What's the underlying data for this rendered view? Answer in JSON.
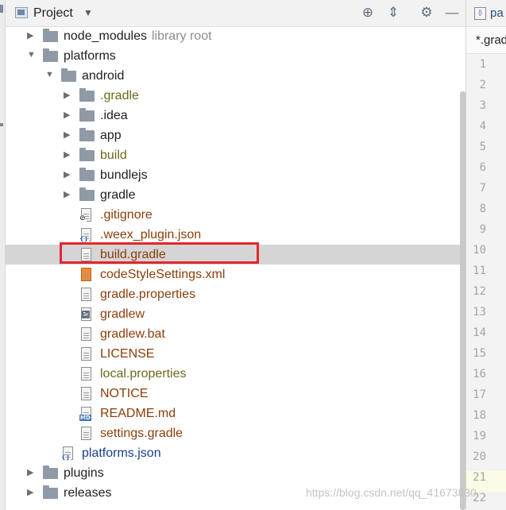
{
  "header": {
    "title": "Project",
    "dropdown_icon": "caret-down-icon",
    "toolbar_icons": [
      "locate-icon",
      "collapse-all-icon",
      "gear-icon",
      "minimize-icon"
    ]
  },
  "tree": [
    {
      "label": "node_modules",
      "hint": "library root",
      "kind": "folder",
      "depth": 0,
      "arrow": "right",
      "color": "black"
    },
    {
      "label": "platforms",
      "kind": "folder",
      "depth": 0,
      "arrow": "down",
      "color": "black"
    },
    {
      "label": "android",
      "kind": "folder",
      "depth": 1,
      "arrow": "down",
      "color": "black"
    },
    {
      "label": ".gradle",
      "kind": "folder",
      "depth": 2,
      "arrow": "right",
      "color": "olive"
    },
    {
      "label": ".idea",
      "kind": "folder",
      "depth": 2,
      "arrow": "right",
      "color": "black"
    },
    {
      "label": "app",
      "kind": "folder",
      "depth": 2,
      "arrow": "right",
      "color": "black"
    },
    {
      "label": "build",
      "kind": "folder",
      "depth": 2,
      "arrow": "right",
      "color": "olive"
    },
    {
      "label": "bundlejs",
      "kind": "folder",
      "depth": 2,
      "arrow": "right",
      "color": "black"
    },
    {
      "label": "gradle",
      "kind": "folder",
      "depth": 2,
      "arrow": "right",
      "color": "black"
    },
    {
      "label": ".gitignore",
      "kind": "file",
      "depth": 2,
      "file_icon": "gitignore-file-icon",
      "color": "brown"
    },
    {
      "label": ".weex_plugin.json",
      "kind": "file",
      "depth": 2,
      "file_icon": "json-file-icon",
      "color": "brown"
    },
    {
      "label": "build.gradle",
      "kind": "file",
      "depth": 2,
      "file_icon": "text-file-icon",
      "color": "brown",
      "selected": true
    },
    {
      "label": "codeStyleSettings.xml",
      "kind": "file",
      "depth": 2,
      "file_icon": "xml-file-icon",
      "color": "brown"
    },
    {
      "label": "gradle.properties",
      "kind": "file",
      "depth": 2,
      "file_icon": "text-file-icon",
      "color": "brown"
    },
    {
      "label": "gradlew",
      "kind": "file",
      "depth": 2,
      "file_icon": "shell-file-icon",
      "color": "brown"
    },
    {
      "label": "gradlew.bat",
      "kind": "file",
      "depth": 2,
      "file_icon": "text-file-icon",
      "color": "brown"
    },
    {
      "label": "LICENSE",
      "kind": "file",
      "depth": 2,
      "file_icon": "text-file-icon",
      "color": "brown"
    },
    {
      "label": "local.properties",
      "kind": "file",
      "depth": 2,
      "file_icon": "text-file-icon",
      "color": "olive"
    },
    {
      "label": "NOTICE",
      "kind": "file",
      "depth": 2,
      "file_icon": "text-file-icon",
      "color": "brown"
    },
    {
      "label": "README.md",
      "kind": "file",
      "depth": 2,
      "file_icon": "markdown-file-icon",
      "color": "brown"
    },
    {
      "label": "settings.gradle",
      "kind": "file",
      "depth": 2,
      "file_icon": "text-file-icon",
      "color": "brown"
    },
    {
      "label": "platforms.json",
      "kind": "file",
      "depth": 1,
      "file_icon": "json-file-icon",
      "color": "blue"
    },
    {
      "label": "plugins",
      "kind": "folder",
      "depth": 0,
      "arrow": "right",
      "color": "black"
    },
    {
      "label": "releases",
      "kind": "folder",
      "depth": 0,
      "arrow": "right",
      "color": "black"
    }
  ],
  "editor": {
    "tab_active": "pa",
    "tab_file": "*.grad",
    "line_numbers": [
      "1",
      "2",
      "3",
      "4",
      "5",
      "6",
      "7",
      "8",
      "9",
      "10",
      "11",
      "12",
      "13",
      "14",
      "15",
      "16",
      "17",
      "18",
      "19",
      "20",
      "21",
      "22"
    ]
  },
  "watermark": "https://blog.csdn.net/qq_41673830",
  "colors": {
    "selection": "#d5d5d5",
    "highlight_box": "#e3262d",
    "folder_gray": "#8f9aa6"
  }
}
